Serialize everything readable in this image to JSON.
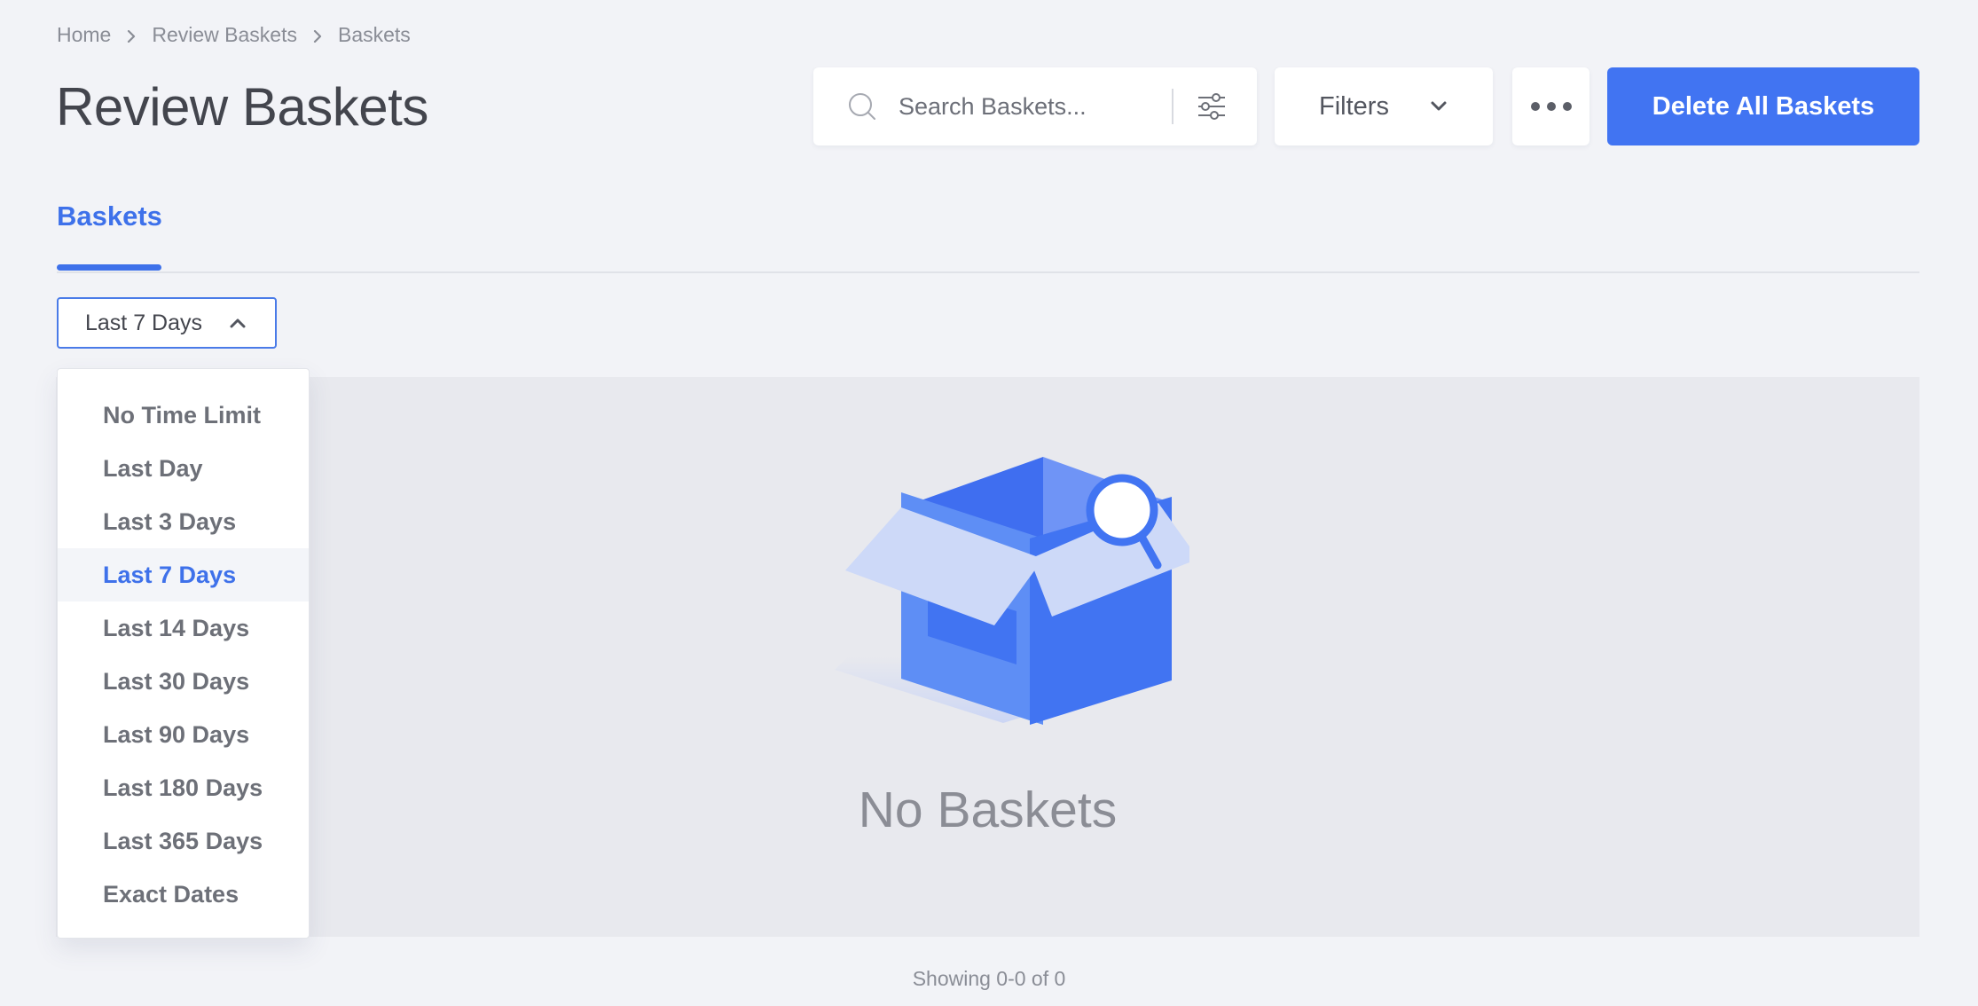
{
  "breadcrumb": {
    "items": [
      "Home",
      "Review Baskets",
      "Baskets"
    ]
  },
  "header": {
    "title": "Review Baskets"
  },
  "toolbar": {
    "search_placeholder": "Search Baskets...",
    "search_value": "",
    "filters_label": "Filters",
    "delete_label": "Delete All Baskets"
  },
  "tabs": [
    {
      "label": "Baskets",
      "active": true
    }
  ],
  "time_filter": {
    "selected": "Last 7 Days",
    "options": [
      "No Time Limit",
      "Last Day",
      "Last 3 Days",
      "Last 7 Days",
      "Last 14 Days",
      "Last 30 Days",
      "Last 90 Days",
      "Last 180 Days",
      "Last 365 Days",
      "Exact Dates"
    ]
  },
  "empty_state": {
    "message": "No Baskets",
    "icon": "open-box-magnifier-icon"
  },
  "pagination": {
    "summary": "Showing 0-0 of 0"
  },
  "colors": {
    "accent": "#4174f2",
    "background": "#f2f3f7",
    "panel": "#e8e9ee"
  }
}
